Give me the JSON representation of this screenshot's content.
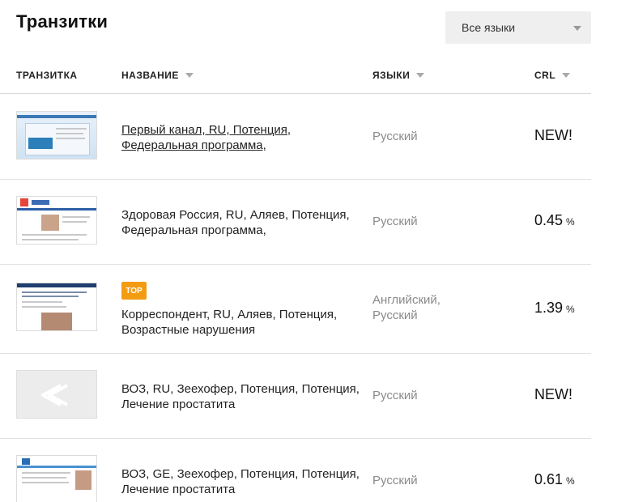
{
  "page": {
    "title": "Транзитки"
  },
  "filter": {
    "language_selected": "Все языки"
  },
  "table": {
    "headers": {
      "thumb": "ТРАНЗИТКА",
      "name": "НАЗВАНИЕ",
      "languages": "ЯЗЫКИ",
      "crl": "CRL"
    },
    "rows": [
      {
        "name": "Первый канал, RU, Потенция, Федеральная программа,",
        "languages": "Русский",
        "crl": "NEW!",
        "crl_unit": "",
        "badge": ""
      },
      {
        "name": "Здоровая Россия, RU, Аляев, Потенция, Федеральная программа,",
        "languages": "Русский",
        "crl": "0.45",
        "crl_unit": "%",
        "badge": ""
      },
      {
        "name": "Корреспондент, RU, Аляев, Потенция, Возрастные нарушения",
        "languages": "Английский, Русский",
        "crl": "1.39",
        "crl_unit": "%",
        "badge": "TOP"
      },
      {
        "name": "ВОЗ, RU, Зеехофер, Потенция, Потенция, Лечение простатита",
        "languages": "Русский",
        "crl": "NEW!",
        "crl_unit": "",
        "badge": ""
      },
      {
        "name": "ВОЗ, GE, Зеехофер, Потенция, Потенция, Лечение простатита",
        "languages": "Русский",
        "crl": "0.61",
        "crl_unit": "%",
        "badge": ""
      }
    ]
  },
  "icons": {
    "dropdown": "chevron-down-icon",
    "sort": "sort-down-icon",
    "placeholder_thumb": "logo-placeholder-icon"
  },
  "colors": {
    "badge_top": "#f39c12",
    "select_bg": "#efefef",
    "muted_text": "#8a8a8a",
    "divider": "#e2e2e2"
  }
}
